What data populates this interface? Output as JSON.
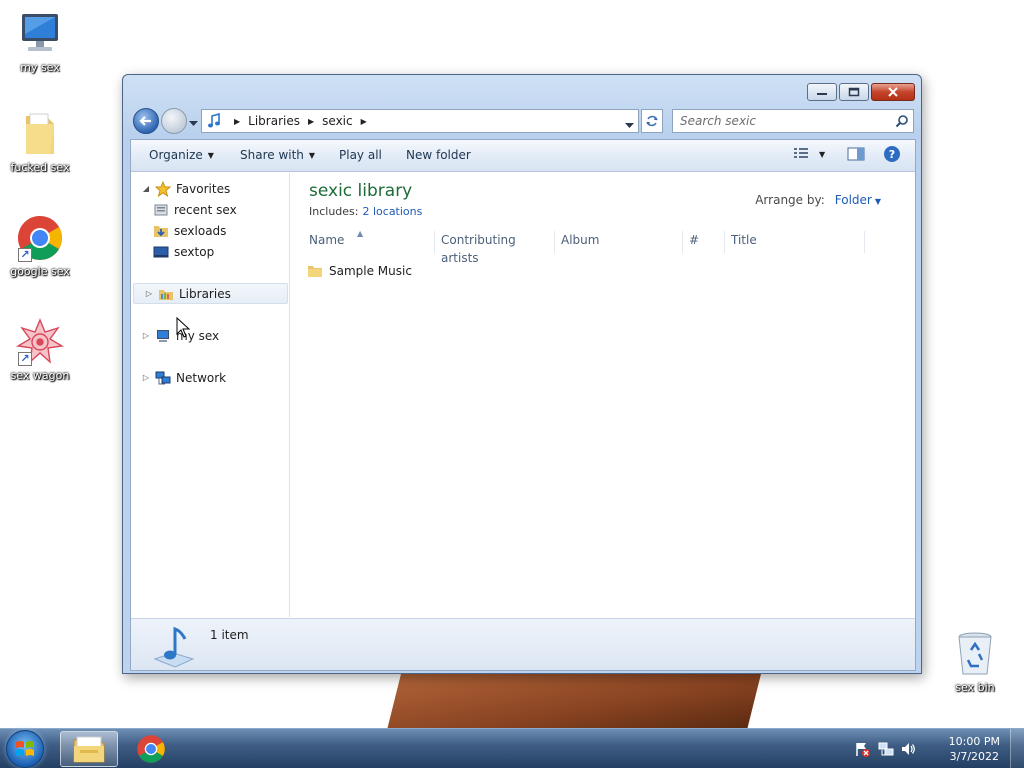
{
  "desktop": {
    "icons": [
      {
        "label": "my sex",
        "icon": "computer-icon"
      },
      {
        "label": "fucked sex",
        "icon": "folder-icon"
      },
      {
        "label": "google sex",
        "icon": "chrome-icon"
      },
      {
        "label": "sex wagon",
        "icon": "wagon-icon"
      },
      {
        "label": "sex bin",
        "icon": "recycle-bin-icon"
      }
    ]
  },
  "window": {
    "address": {
      "crumbs": [
        "Libraries",
        "sexic"
      ]
    },
    "search": {
      "placeholder": "Search sexic"
    },
    "toolbar": {
      "organize": "Organize",
      "share_with": "Share with",
      "play_all": "Play all",
      "new_folder": "New folder"
    },
    "nav": {
      "favorites": "Favorites",
      "favorites_items": [
        "recent sex",
        "sexloads",
        "sextop"
      ],
      "libraries": "Libraries",
      "computer": "my sex",
      "network": "Network"
    },
    "library": {
      "title": "sexic library",
      "includes_label": "Includes:",
      "locations": "2 locations",
      "arrange_label": "Arrange by:",
      "arrange_value": "Folder"
    },
    "columns": [
      "Name",
      "Contributing artists",
      "Album",
      "#",
      "Title"
    ],
    "items": [
      {
        "name": "Sample Music",
        "type": "folder"
      }
    ],
    "details": {
      "count": "1 item"
    }
  },
  "taskbar": {
    "apps": [
      "windows-explorer",
      "google-chrome"
    ],
    "clock": {
      "time": "10:00 PM",
      "date": "3/7/2022"
    }
  },
  "colors": {
    "library_title": "#1e6a39",
    "link": "#1e5bb6",
    "taskbar": "#3f5e85"
  }
}
